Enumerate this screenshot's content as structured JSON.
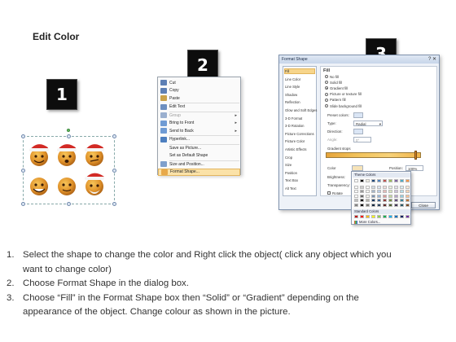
{
  "title": "Edit Color",
  "steps": {
    "one": "1",
    "two": "2",
    "three": "3"
  },
  "context_menu": {
    "items": [
      {
        "label": "Cut",
        "icon": "scissors-icon",
        "color": "#5d7fb5"
      },
      {
        "label": "Copy",
        "icon": "copy-icon",
        "color": "#5d7fb5"
      },
      {
        "label": "Paste",
        "icon": "paste-icon",
        "color": "#caa24a"
      },
      {
        "label": "Edit Text",
        "icon": "edit-text-icon",
        "color": "#6d8fc0"
      },
      {
        "label": "Group",
        "icon": "group-icon",
        "color": "#9bb0cf",
        "arrow": "▸"
      },
      {
        "label": "Bring to Front",
        "icon": "bring-front-icon",
        "color": "#6f9bd4",
        "arrow": "▸"
      },
      {
        "label": "Send to Back",
        "icon": "send-back-icon",
        "color": "#6f9bd4",
        "arrow": "▸"
      },
      {
        "label": "Hyperlink...",
        "icon": "hyperlink-icon",
        "color": "#4d7fbf"
      },
      {
        "label": "Save as Picture...",
        "icon": "",
        "color": ""
      },
      {
        "label": "Set as Default Shape",
        "icon": "",
        "color": ""
      },
      {
        "label": "Size and Position...",
        "icon": "size-icon",
        "color": "#7fa0cc"
      },
      {
        "label": "Format Shape...",
        "icon": "format-icon",
        "color": "#e8a94a"
      }
    ]
  },
  "dialog": {
    "title": "Format Shape",
    "close_glyph": "? ✕",
    "categories": [
      "Fill",
      "Line Color",
      "Line Style",
      "Shadow",
      "Reflection",
      "Glow and Soft Edges",
      "3-D Format",
      "3-D Rotation",
      "Picture Corrections",
      "Picture Color",
      "Artistic Effects",
      "Crop",
      "Size",
      "Position",
      "Text Box",
      "Alt Text"
    ],
    "pane_heading": "Fill",
    "fill_options": [
      {
        "label": "No fill",
        "selected": false
      },
      {
        "label": "Solid fill",
        "selected": false
      },
      {
        "label": "Gradient fill",
        "selected": true
      },
      {
        "label": "Picture or texture fill",
        "selected": false
      },
      {
        "label": "Pattern fill",
        "selected": false
      },
      {
        "label": "Slide background fill",
        "selected": false
      }
    ],
    "preset_label": "Preset colors:",
    "type_label": "Type:",
    "type_value": "Radial",
    "direction_label": "Direction:",
    "angle_label": "Angle:",
    "angle_value": "0°",
    "stops_label": "Gradient stops",
    "color_label": "Color",
    "position_label": "Position:",
    "position_value": "100%",
    "brightness_label": "Brightness:",
    "transparency_label": "Transparency:",
    "rotate_label": "Rotate",
    "close_label": "Close"
  },
  "palette": {
    "theme_header": "Theme Colors",
    "standard_header": "Standard Colors",
    "more_label": "More Colors...",
    "theme_top": [
      "#ffffff",
      "#000000",
      "#eeece1",
      "#1f497d",
      "#4f81bd",
      "#c0504d",
      "#9bbb59",
      "#8064a2",
      "#4bacc6",
      "#f79646"
    ],
    "standard": [
      "#c00000",
      "#ff0000",
      "#ffc000",
      "#ffff00",
      "#92d050",
      "#00b050",
      "#00b0f0",
      "#0070c0",
      "#002060",
      "#7030a0"
    ]
  },
  "instructions": [
    {
      "n": "1.",
      "text": "Select the shape to change the color and Right click the object( click any object which you"
    },
    {
      "n": "",
      "text": "want to change color)"
    },
    {
      "n": "2.",
      "text": "Choose Format Shape in the dialog box."
    },
    {
      "n": "3.",
      "text": "Choose “Fill” in the Format Shape box then “Solid” or “Gradient” depending on the"
    },
    {
      "n": "",
      "text": "appearance of the object. Change colour as shown in the picture."
    }
  ]
}
